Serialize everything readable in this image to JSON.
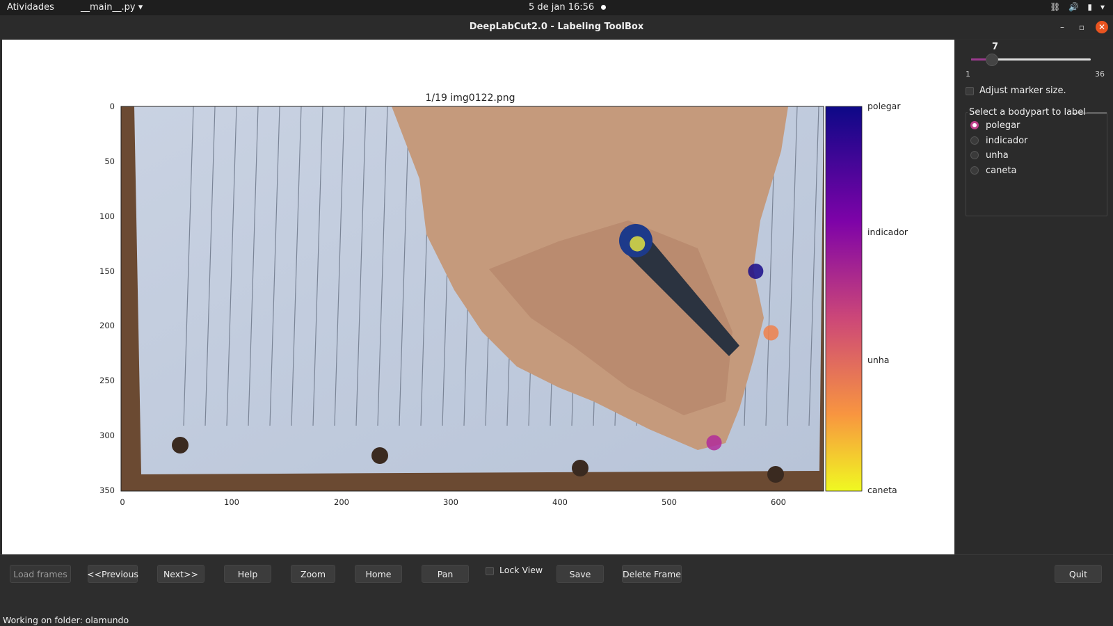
{
  "topbar": {
    "activities": "Atividades",
    "app_menu": "__main__.py",
    "clock": "5 de jan  16:56"
  },
  "window": {
    "title": "DeepLabCut2.0 - Labeling ToolBox"
  },
  "plot": {
    "title": "1/19 img0122.png",
    "x_ticks": [
      "0",
      "100",
      "200",
      "300",
      "400",
      "500",
      "600"
    ],
    "y_ticks": [
      "0",
      "50",
      "100",
      "150",
      "200",
      "250",
      "300",
      "350"
    ],
    "colorbar_labels": [
      "polegar",
      "indicador",
      "unha",
      "caneta"
    ]
  },
  "chart_data": {
    "type": "scatter",
    "title": "1/19 img0122.png",
    "xlim": [
      0,
      640
    ],
    "ylim": [
      350,
      0
    ],
    "series": [
      {
        "name": "polegar",
        "color": "#1a0c8a",
        "x": [
          578
        ],
        "y": [
          150
        ]
      },
      {
        "name": "indicador",
        "color": "#b02c9a",
        "x": [
          540
        ],
        "y": [
          306
        ]
      },
      {
        "name": "unha",
        "color": "#f0804a",
        "x": [
          592
        ],
        "y": [
          206
        ]
      },
      {
        "name": "caneta",
        "color": "#e0e040",
        "x": [
          470
        ],
        "y": [
          125
        ]
      }
    ]
  },
  "side": {
    "slider_value": "7",
    "slider_min": "1",
    "slider_max": "36",
    "slider_fraction": 0.17,
    "adjust_label": "Adjust marker size.",
    "group_title": "Select a bodypart to label",
    "bodyparts": [
      "polegar",
      "indicador",
      "unha",
      "caneta"
    ],
    "selected": "polegar"
  },
  "toolbar": {
    "load": "Load frames",
    "prev": "<<Previous",
    "next": "Next>>",
    "help": "Help",
    "zoom": "Zoom",
    "home": "Home",
    "pan": "Pan",
    "lock": "Lock View",
    "save": "Save",
    "delete": "Delete Frame",
    "quit": "Quit"
  },
  "status": "Working on folder: olamundo"
}
